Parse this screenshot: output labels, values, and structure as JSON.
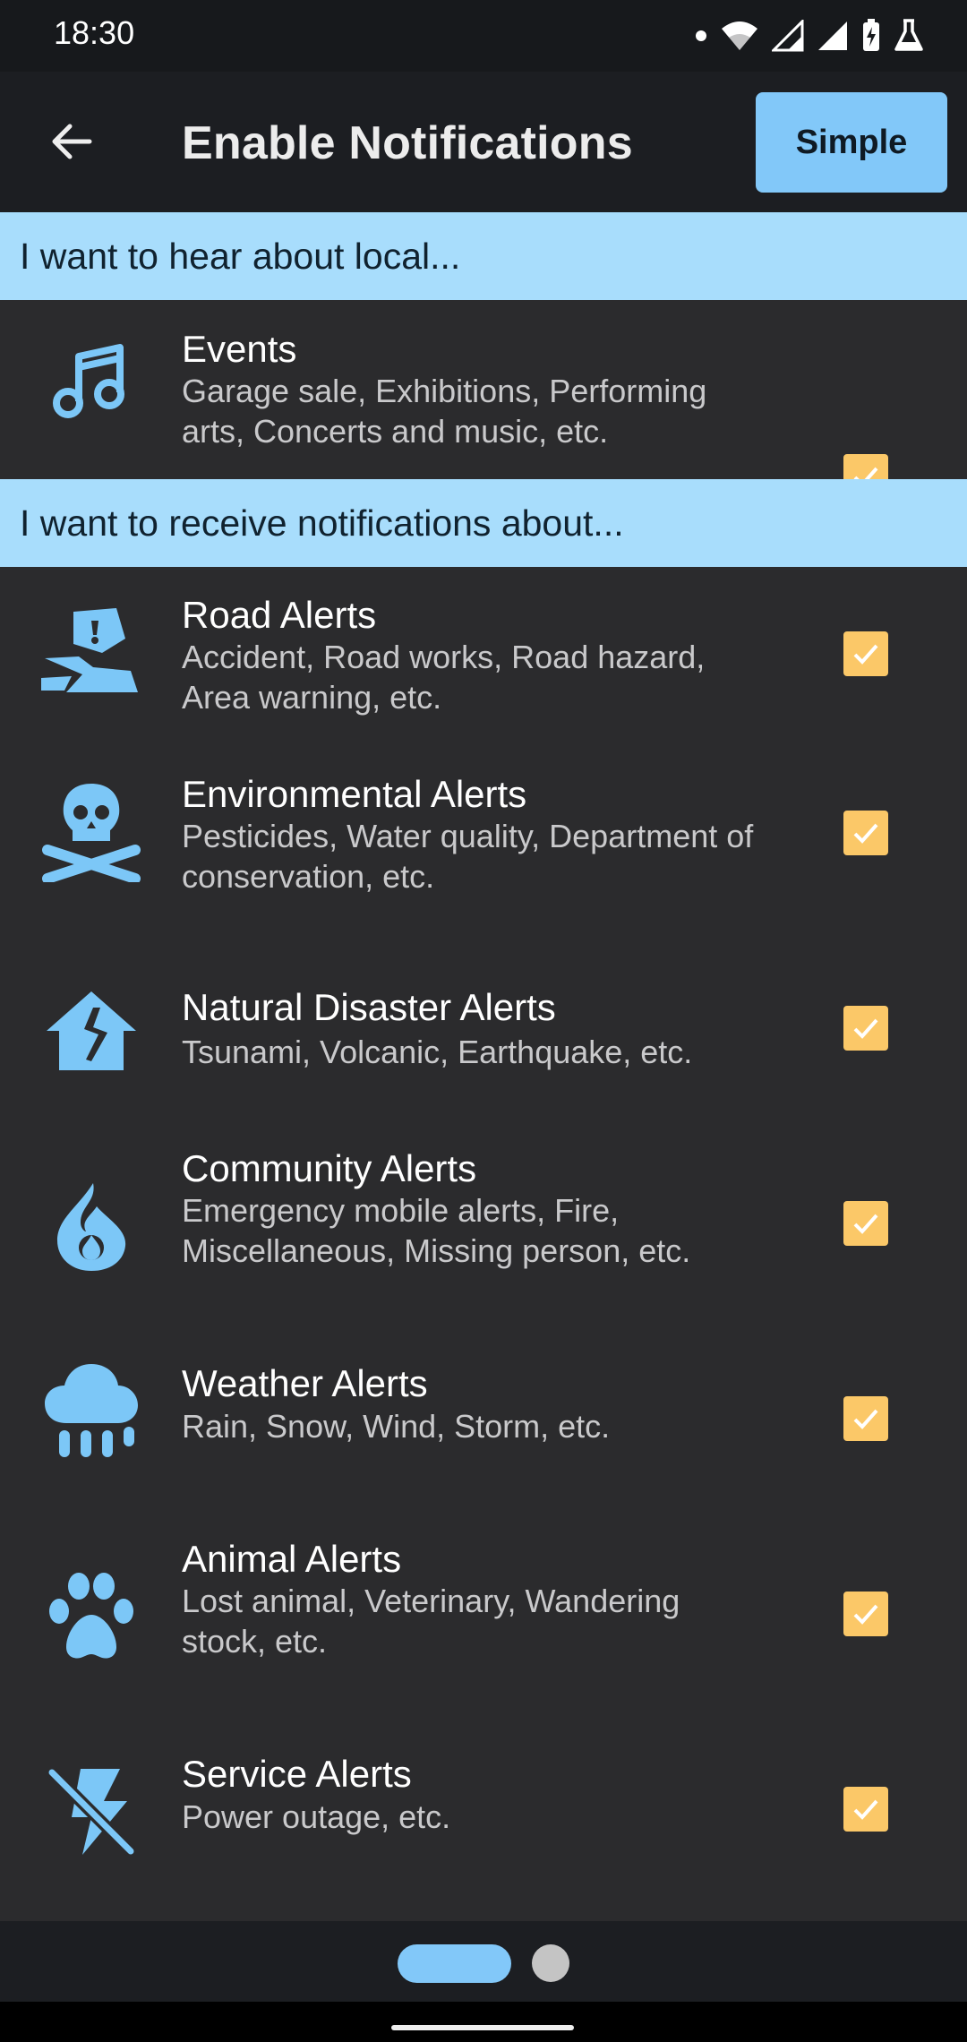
{
  "status_bar": {
    "time": "18:30"
  },
  "app_bar": {
    "title": "Enable Notifications",
    "mode_button": "Simple"
  },
  "sections": [
    {
      "header": "I want to hear about local..."
    },
    {
      "header": "I want to receive notifications about..."
    }
  ],
  "items": [
    {
      "title": "Events",
      "desc": "Garage sale, Exhibitions, Performing arts, Concerts and music, etc.",
      "icon": "music-note-icon",
      "checked": true
    },
    {
      "title": "Road Alerts",
      "desc": "Accident, Road works, Road hazard, Area warning, etc.",
      "icon": "road-hazard-icon",
      "checked": true
    },
    {
      "title": "Environmental Alerts",
      "desc": "Pesticides, Water quality, Department of conservation, etc.",
      "icon": "skull-crossbones-icon",
      "checked": true
    },
    {
      "title": "Natural Disaster Alerts",
      "desc": "Tsunami, Volcanic, Earthquake, etc.",
      "icon": "house-crack-icon",
      "checked": true
    },
    {
      "title": "Community Alerts",
      "desc": "Emergency mobile alerts, Fire, Miscellaneous, Missing person, etc.",
      "icon": "fire-icon",
      "checked": true
    },
    {
      "title": "Weather Alerts",
      "desc": "Rain, Snow, Wind, Storm, etc.",
      "icon": "cloud-rain-icon",
      "checked": true
    },
    {
      "title": "Animal Alerts",
      "desc": "Lost animal, Veterinary, Wandering stock, etc.",
      "icon": "paw-icon",
      "checked": true
    },
    {
      "title": "Service Alerts",
      "desc": "Power outage, etc.",
      "icon": "power-off-icon",
      "checked": true
    }
  ],
  "pager": {
    "pages": 2,
    "current": 1
  },
  "colors": {
    "accent": "#82c8f9",
    "section_bg": "#a8ddfc",
    "checkbox": "#fbc868",
    "list_bg": "#2b2b2d",
    "icon": "#7cc7f7"
  }
}
